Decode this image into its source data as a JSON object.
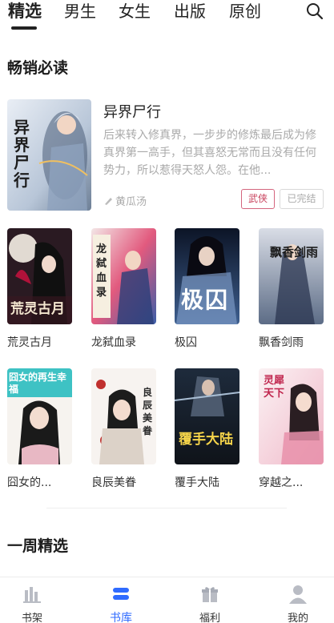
{
  "tabs": [
    {
      "label": "精选",
      "active": true
    },
    {
      "label": "男生",
      "active": false
    },
    {
      "label": "女生",
      "active": false
    },
    {
      "label": "出版",
      "active": false
    },
    {
      "label": "原创",
      "active": false
    }
  ],
  "sections": {
    "bestsellers_title": "畅销必读",
    "weekly_title": "一周精选"
  },
  "featured": {
    "title": "异界尸行",
    "description": "后来转入修真界，一步步的修炼最后成为修真界第一高手，但其喜怒无常而且没有任何势力，所以惹得天怒人怨。在他...",
    "author": "黄瓜汤",
    "genre_tag": "武侠",
    "status_tag": "已完结",
    "cover_text": "异界尸行"
  },
  "grid_books": [
    {
      "title": "荒灵古月",
      "cover_text": "荒灵古月"
    },
    {
      "title": "龙弑血录",
      "cover_text": "龙弑血录"
    },
    {
      "title": "极囚",
      "cover_text": "极囚"
    },
    {
      "title": "飘香剑雨",
      "cover_text": "飘香剑雨"
    },
    {
      "title": "囧女的...",
      "cover_text": "囧女的再生幸福"
    },
    {
      "title": "良辰美眷",
      "cover_text": "良辰美眷"
    },
    {
      "title": "覆手大陆",
      "cover_text": "覆手大陆"
    },
    {
      "title": "穿越之...",
      "cover_text": "灵犀天下"
    }
  ],
  "bottom_nav": [
    {
      "label": "书架",
      "icon": "bookshelf-icon",
      "active": false
    },
    {
      "label": "书库",
      "icon": "library-icon",
      "active": true
    },
    {
      "label": "福利",
      "icon": "gift-icon",
      "active": false
    },
    {
      "label": "我的",
      "icon": "profile-icon",
      "active": false
    }
  ],
  "colors": {
    "accent": "#2f6bff",
    "genre_tag": "#c8415c",
    "muted_text": "#aaaaaa"
  }
}
